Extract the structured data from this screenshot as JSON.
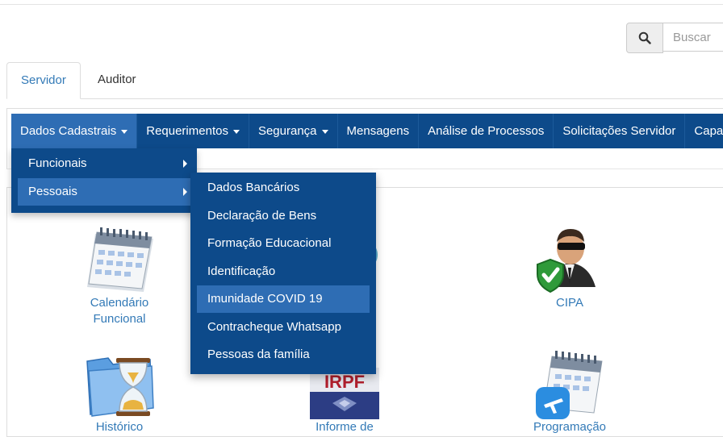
{
  "search": {
    "placeholder": "Buscar"
  },
  "tabs": [
    {
      "label": "Servidor"
    },
    {
      "label": "Auditor"
    }
  ],
  "navbar": {
    "items": [
      {
        "label": "Dados Cadastrais"
      },
      {
        "label": "Requerimentos"
      },
      {
        "label": "Segurança"
      },
      {
        "label": "Mensagens"
      },
      {
        "label": "Análise de Processos"
      },
      {
        "label": "Solicitações Servidor"
      },
      {
        "label": "Capac"
      }
    ]
  },
  "dropdown_dados": {
    "items": [
      {
        "label": "Funcionais"
      },
      {
        "label": "Pessoais"
      }
    ]
  },
  "dropdown_pessoais": {
    "items": [
      {
        "label": "Dados Bancários"
      },
      {
        "label": "Declaração de Bens"
      },
      {
        "label": "Formação Educacional"
      },
      {
        "label": "Identificação"
      },
      {
        "label": "Imunidade COVID 19"
      },
      {
        "label": "Contracheque Whatsapp"
      },
      {
        "label": "Pessoas da família"
      }
    ]
  },
  "shortcuts": {
    "calendario": {
      "line1": "Calendário",
      "line2": "Funcional",
      "icon": "calendar-icon"
    },
    "cipa": {
      "label": "CIPA",
      "icon": "security-guard-icon"
    },
    "historico": {
      "label": "Histórico",
      "icon": "folder-hourglass-icon"
    },
    "informe": {
      "label": "Informe de",
      "icon": "irpf-icon",
      "icon_text": "IRPF"
    },
    "programacao": {
      "label": "Programação",
      "icon": "calendar-plane-icon"
    }
  },
  "colors": {
    "navbar": "#0d4a8a",
    "navbar_active": "#2e6db4",
    "link": "#337ab7"
  }
}
